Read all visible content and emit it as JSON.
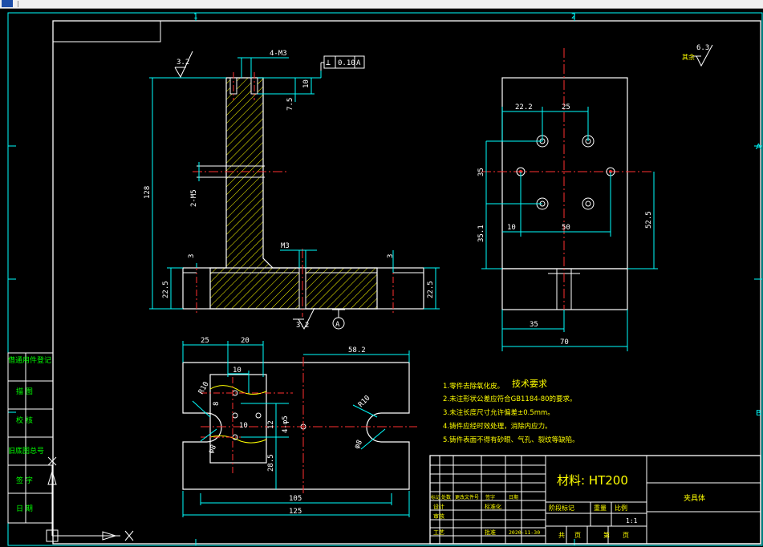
{
  "zones": {
    "top_1": "1",
    "top_2": "2",
    "side_a": "A",
    "side_b": "B"
  },
  "roughness": {
    "top_left": "3.2",
    "bottom": "3.2",
    "general": "6.3",
    "general_label": "其余"
  },
  "front_view": {
    "thread_top": "4-M3",
    "tol_symbol": "⊥",
    "tol_value": "0.10",
    "tol_datum": "A",
    "dim_10": "10",
    "dim_75": "7.5",
    "dim_128": "128",
    "thread_side": "2-M5",
    "dim_3_left": "3",
    "dim_3_right": "3",
    "dim_225_left": "22.5",
    "dim_225_right": "22.5",
    "thread_base": "M3",
    "datum": "A"
  },
  "side_view": {
    "dim_222": "22.2",
    "dim_25": "25",
    "dim_35": "35",
    "dim_351": "35.1",
    "dim_10": "10",
    "dim_50": "50",
    "dim_525": "52.5",
    "dim_35_bottom": "35",
    "dim_70": "70"
  },
  "top_view": {
    "dim_25": "25",
    "dim_20": "20",
    "dim_582": "58.2",
    "dim_10": "10",
    "r10_left": "R10",
    "r10_right": "R10",
    "dim_8": "8",
    "dim_10b": "10",
    "dim_12": "12",
    "holes": "4-φ5",
    "dim_285": "28.5",
    "dia_left": "φ8",
    "dia_right": "φ8",
    "dim_105": "105",
    "dim_125": "125"
  },
  "tech": {
    "title": "技术要求",
    "items": [
      "1.零件去除氧化皮。",
      "2.未注形状公差应符合GB1184-80的要求。",
      "3.未注长度尺寸允许偏差±0.5mm。",
      "4.铸件应经时效处理，消除内应力。",
      "5.铸件表面不得有砂眼、气孔、裂纹等缺陷。"
    ]
  },
  "left_strip": [
    "借通用件登记",
    "描 图",
    "校 核",
    "旧底图总号",
    "签 字",
    "日 期"
  ],
  "title_block": {
    "material": "材料: HT200",
    "part_name": "夹具体",
    "stage_mark": "阶段标记",
    "weight": "重量",
    "scale": "比例",
    "scale_value": "1:1",
    "sheet_total": "共",
    "sheet_total_unit": "页",
    "sheet_no": "第",
    "sheet_no_unit": "页",
    "row_marks": [
      "标记",
      "处数",
      "更改文件号",
      "签字",
      "日期"
    ],
    "design": "设计",
    "standard": "标准化",
    "review": "审核",
    "process": "工艺",
    "approve": "批准",
    "date": "2020-11-30"
  }
}
